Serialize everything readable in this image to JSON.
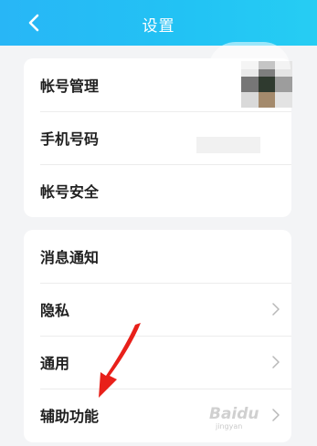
{
  "header": {
    "title": "设置",
    "back_icon": "back-arrow-icon"
  },
  "group1": [
    {
      "label": "帐号管理",
      "name": "row-account-management"
    },
    {
      "label": "手机号码",
      "name": "row-phone-number"
    },
    {
      "label": "帐号安全",
      "name": "row-account-security"
    }
  ],
  "group2": [
    {
      "label": "消息通知",
      "name": "row-notifications"
    },
    {
      "label": "隐私",
      "name": "row-privacy"
    },
    {
      "label": "通用",
      "name": "row-general"
    },
    {
      "label": "辅助功能",
      "name": "row-accessibility"
    }
  ],
  "colors": {
    "header": "#22c3f4",
    "annotation_arrow": "#e8201a",
    "chevron": "#b8b8b8"
  },
  "watermark": {
    "text": "Baidu",
    "sub": "jingyan"
  }
}
